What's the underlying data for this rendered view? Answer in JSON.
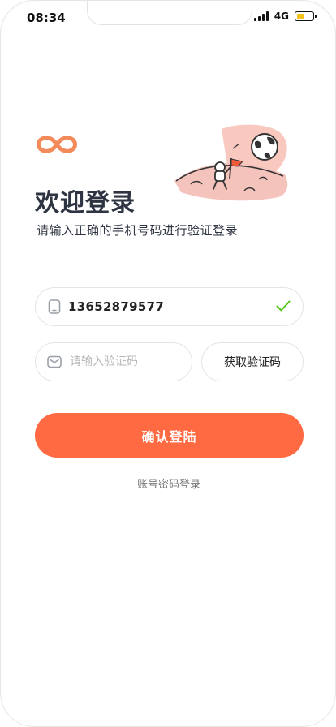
{
  "status_bar": {
    "time": "08:34",
    "network": "4G",
    "battery_level": 0.45,
    "battery_color": "#f5c21b"
  },
  "header": {
    "logo_icon": "infinity-logo-icon",
    "illustration": "astronaut-planting-flag-illustration",
    "title": "欢迎登录",
    "subtitle": "请输入正确的手机号码进行验证登录"
  },
  "form": {
    "phone_icon": "phone-icon",
    "phone_value": "13652879577",
    "phone_valid_icon": "check-icon",
    "code_icon": "message-icon",
    "code_placeholder": "请输入验证码",
    "get_code_label": "获取验证码",
    "submit_label": "确认登陆",
    "alt_login_label": "账号密码登录"
  },
  "colors": {
    "accent": "#ff6a42",
    "text_dark": "#2e3442",
    "check_green": "#52c41a"
  }
}
